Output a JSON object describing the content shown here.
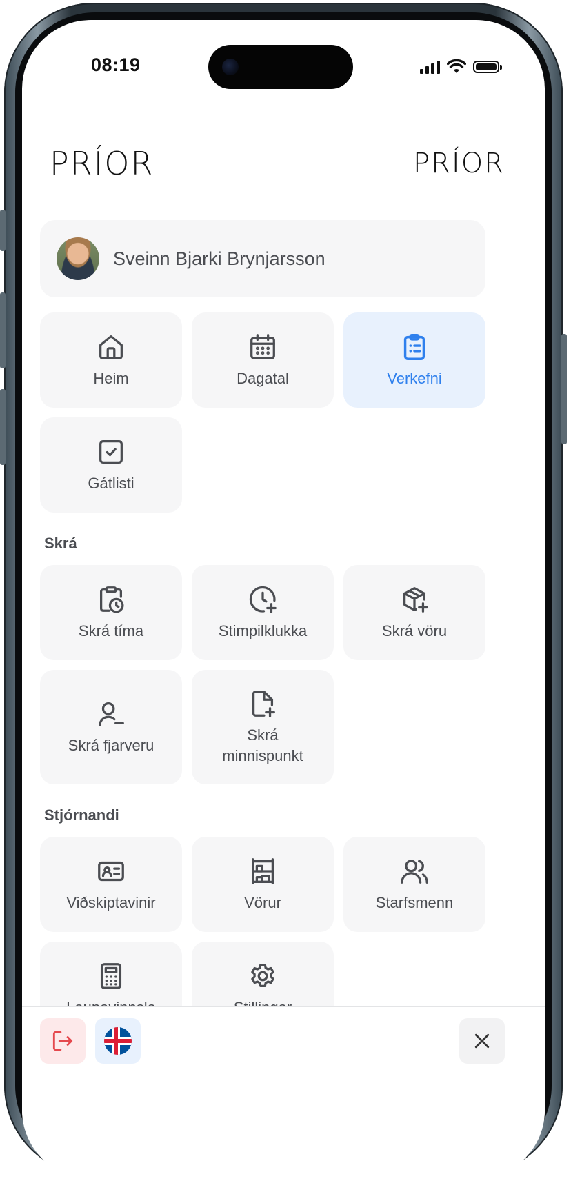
{
  "status_bar": {
    "time": "08:19"
  },
  "header": {
    "logo_left": "PRÍOR",
    "logo_right": "PRÍOR"
  },
  "profile": {
    "name": "Sveinn Bjarki Brynjarsson"
  },
  "nav": {
    "items": [
      {
        "label": "Heim",
        "icon": "home-icon"
      },
      {
        "label": "Dagatal",
        "icon": "calendar-icon"
      },
      {
        "label": "Verkefni",
        "icon": "clipboard-list-icon",
        "active": true
      },
      {
        "label": "Gátlisti",
        "icon": "checkbox-icon"
      }
    ]
  },
  "sections": {
    "skra": {
      "title": "Skrá",
      "items": [
        {
          "label": "Skrá tíma",
          "icon": "clipboard-clock-icon"
        },
        {
          "label": "Stimpilklukka",
          "icon": "clock-plus-icon"
        },
        {
          "label": "Skrá vöru",
          "icon": "package-plus-icon"
        },
        {
          "label": "Skrá fjarveru",
          "icon": "user-minus-icon"
        },
        {
          "label_line1": "Skrá",
          "label_line2": "minnispunkt",
          "icon": "file-plus-icon"
        }
      ]
    },
    "stjornandi": {
      "title": "Stjórnandi",
      "items": [
        {
          "label": "Viðskiptavinir",
          "icon": "id-card-icon"
        },
        {
          "label": "Vörur",
          "icon": "shelves-icon"
        },
        {
          "label": "Starfsmenn",
          "icon": "users-icon"
        },
        {
          "label": "Launavinnsla",
          "icon": "calculator-icon"
        },
        {
          "label": "Stillingar",
          "icon": "gear-icon"
        }
      ]
    }
  },
  "footer": {
    "logout_icon": "logout-icon",
    "language_icon": "iceland-flag-icon",
    "close_icon": "close-icon"
  },
  "colors": {
    "accent": "#2f80ed",
    "active_bg": "#e8f1fd",
    "tile_bg": "#f6f6f7",
    "logout_red": "#e5484d"
  }
}
